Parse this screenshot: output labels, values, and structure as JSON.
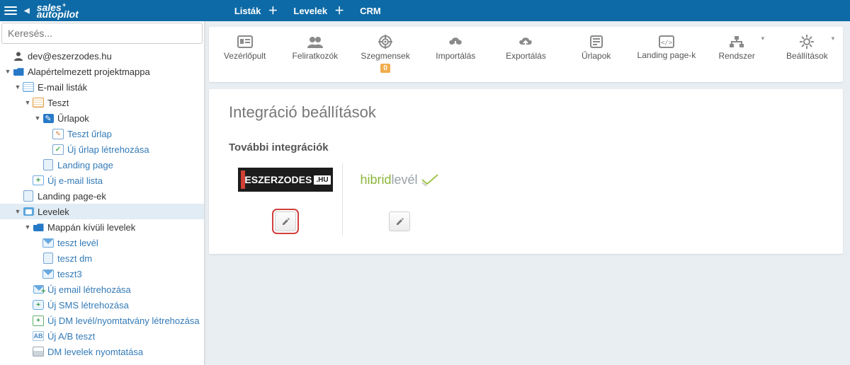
{
  "brand": {
    "line1": "sales",
    "line2": "autopilot"
  },
  "top_nav": [
    {
      "label": "Listák",
      "has_plus": true
    },
    {
      "label": "Levelek",
      "has_plus": true
    },
    {
      "label": "CRM",
      "has_plus": false
    }
  ],
  "search": {
    "placeholder": "Keresés..."
  },
  "sidebar": {
    "user": "dev@eszerzodes.hu",
    "items": [
      {
        "d": 1,
        "tw": "",
        "icon": "user",
        "label": "dev@eszerzodes.hu"
      },
      {
        "d": 1,
        "tw": "▼",
        "icon": "folder-blue",
        "label": "Alapértelmezett projektmappa"
      },
      {
        "d": 2,
        "tw": "▼",
        "icon": "list",
        "label": "E-mail listák"
      },
      {
        "d": 3,
        "tw": "▼",
        "icon": "list-orange",
        "label": "Teszt"
      },
      {
        "d": 4,
        "tw": "▼",
        "icon": "form-blue",
        "label": "Űrlapok"
      },
      {
        "d": 5,
        "tw": "",
        "icon": "doc-pen",
        "label": "Teszt űrlap",
        "link": true
      },
      {
        "d": 5,
        "tw": "",
        "icon": "doc-green",
        "label": "Új űrlap létrehozása",
        "link": true
      },
      {
        "d": 4,
        "tw": "",
        "icon": "doc",
        "label": "Landing page",
        "link": true
      },
      {
        "d": 3,
        "tw": "",
        "icon": "list-plus",
        "label": "Új e-mail lista",
        "link": true
      },
      {
        "d": 2,
        "tw": "",
        "icon": "doc",
        "label": "Landing page-ek"
      },
      {
        "d": 2,
        "tw": "▼",
        "icon": "mail-panel",
        "label": "Levelek",
        "sel": true
      },
      {
        "d": 3,
        "tw": "▼",
        "icon": "folder-blue",
        "label": "Mappán kívüli levelek"
      },
      {
        "d": 4,
        "tw": "",
        "icon": "mail",
        "label": "teszt levél",
        "link": true
      },
      {
        "d": 4,
        "tw": "",
        "icon": "doc",
        "label": "teszt dm",
        "link": true
      },
      {
        "d": 4,
        "tw": "",
        "icon": "mail",
        "label": "teszt3",
        "link": true
      },
      {
        "d": 3,
        "tw": "",
        "icon": "mail-plus",
        "label": "Új email létrehozása",
        "link": true
      },
      {
        "d": 3,
        "tw": "",
        "icon": "sms-plus",
        "label": "Új SMS létrehozása",
        "link": true
      },
      {
        "d": 3,
        "tw": "",
        "icon": "dm-plus",
        "label": "Új DM levél/nyomtatvány létrehozása",
        "link": true
      },
      {
        "d": 3,
        "tw": "",
        "icon": "ab-plus",
        "label": "Új A/B teszt",
        "link": true
      },
      {
        "d": 3,
        "tw": "",
        "icon": "print",
        "label": "DM levelek nyomtatása",
        "link": true
      }
    ]
  },
  "tiles": [
    {
      "key": "dashboard",
      "label": "Vezérlőpult",
      "icon": "id"
    },
    {
      "key": "subscribers",
      "label": "Feliratkozók",
      "icon": "users"
    },
    {
      "key": "segments",
      "label": "Szegmensek",
      "icon": "target",
      "badge": "0"
    },
    {
      "key": "import",
      "label": "Importálás",
      "icon": "cloud-down"
    },
    {
      "key": "export",
      "label": "Exportálás",
      "icon": "cloud-up"
    },
    {
      "key": "forms",
      "label": "Űrlapok",
      "icon": "form"
    },
    {
      "key": "landing",
      "label": "Landing page-k",
      "icon": "code"
    },
    {
      "key": "system",
      "label": "Rendszer",
      "icon": "sitemap",
      "dd": true
    },
    {
      "key": "settings",
      "label": "Beállítások",
      "icon": "gear",
      "dd": true
    }
  ],
  "panel": {
    "title": "Integráció beállítások",
    "subtitle": "További integrációk",
    "cards": [
      {
        "key": "eszerzodes",
        "brand_main": "ESZERZODES",
        "brand_suffix": ".HU",
        "active": true
      },
      {
        "key": "hibridlevel",
        "brand_a": "hibrid",
        "brand_b": "levél",
        "active": false
      }
    ]
  }
}
